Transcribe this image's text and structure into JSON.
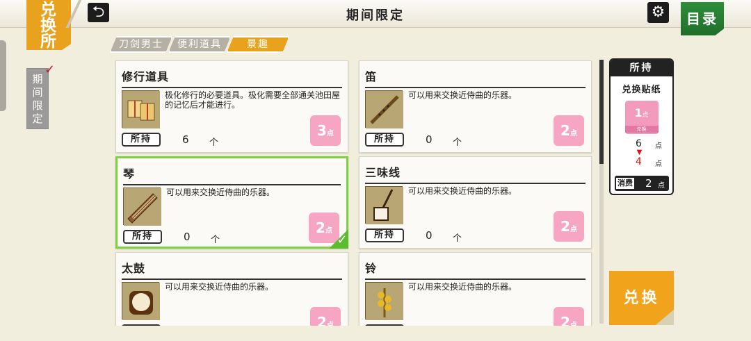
{
  "header": {
    "shop_logo": [
      "兑",
      "换",
      "所"
    ],
    "back_icon": "return-arrow",
    "title": "期间限定",
    "settings_icon": "gear",
    "menu_label": "目录"
  },
  "side_tab": {
    "label": [
      "期",
      "间",
      "限",
      "定"
    ],
    "check": "✓"
  },
  "categories": [
    {
      "label": "刀剑男士",
      "active": false
    },
    {
      "label": "便利道具",
      "active": false
    },
    {
      "label": "景趣",
      "active": true
    }
  ],
  "cards": [
    {
      "name": "修行道具",
      "description": "极化修行的必要道具。极化需要全部通关池田屋的记忆后才能进行。",
      "held_label": "所持",
      "held_count": "6",
      "unit": "个",
      "cost": "3",
      "cost_unit": "点",
      "image": "bundle-icon",
      "selected": false
    },
    {
      "name": "笛",
      "description": "可以用来交换近侍曲的乐器。",
      "held_label": "所持",
      "held_count": "0",
      "unit": "个",
      "cost": "2",
      "cost_unit": "点",
      "image": "flute-icon",
      "selected": false
    },
    {
      "name": "琴",
      "description": "可以用来交换近侍曲的乐器。",
      "held_label": "所持",
      "held_count": "0",
      "unit": "个",
      "cost": "2",
      "cost_unit": "点",
      "image": "koto-icon",
      "selected": true
    },
    {
      "name": "三味线",
      "description": "可以用来交换近侍曲的乐器。",
      "held_label": "所持",
      "held_count": "0",
      "unit": "个",
      "cost": "2",
      "cost_unit": "点",
      "image": "shamisen-icon",
      "selected": false
    },
    {
      "name": "太鼓",
      "description": "可以用来交换近侍曲的乐器。",
      "held_label": "所持",
      "held_count": "",
      "unit": "",
      "cost": "2",
      "cost_unit": "点",
      "image": "drum-icon",
      "selected": false
    },
    {
      "name": "铃",
      "description": "可以用来交换近侍曲的乐器。",
      "held_label": "所持",
      "held_count": "",
      "unit": "",
      "cost": "2",
      "cost_unit": "点",
      "image": "bell-icon",
      "selected": false
    }
  ],
  "holding": {
    "title": "所持",
    "item": "兑换贴纸",
    "ticket_value": "1",
    "ticket_unit": "点",
    "ticket_label": "兑换",
    "current": "6",
    "after": "4",
    "unit": "点",
    "cost_label": "消费",
    "cost": "2"
  },
  "exchange_button": "兑换",
  "colors": {
    "accent": "#e8a21e",
    "menu_green": "#2f8e3a",
    "badge_pink": "#f6a6c3",
    "selected_border": "#7ed142"
  }
}
